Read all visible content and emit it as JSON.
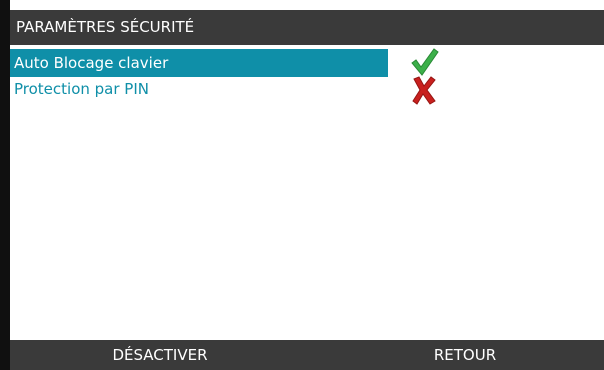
{
  "header": {
    "title": "PARAMÈTRES SÉCURITÉ"
  },
  "menu": {
    "items": [
      {
        "label": "Auto Blocage clavier",
        "selected": true,
        "status": "enabled",
        "status_icon": "checkmark-icon"
      },
      {
        "label": "Protection par PIN",
        "selected": false,
        "status": "disabled",
        "status_icon": "cross-icon"
      }
    ]
  },
  "footer": {
    "left_softkey": "DÉSACTIVER",
    "right_softkey": "RETOUR"
  },
  "colors": {
    "accent": "#0f8fa8",
    "bar": "#3a3a3a",
    "check": "#3cb04a",
    "cross": "#c8201e"
  }
}
